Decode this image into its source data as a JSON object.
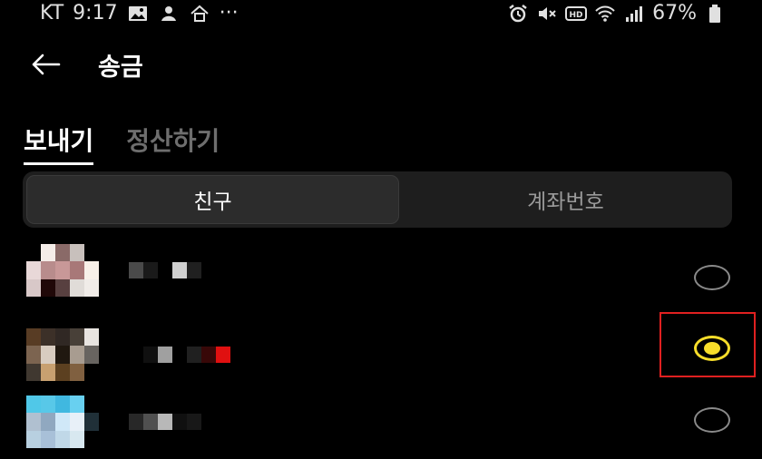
{
  "status_bar": {
    "carrier": "KT",
    "time": "9:17",
    "more": "···",
    "battery": "67%"
  },
  "header": {
    "title": "송금"
  },
  "tabs": [
    {
      "label": "보내기",
      "active": true
    },
    {
      "label": "정산하기",
      "active": false
    }
  ],
  "segment": {
    "options": [
      "친구",
      "계좌번호"
    ],
    "selected": "친구"
  },
  "friends": [
    {
      "selected": false,
      "avatar_colors": [
        "#000000",
        "#f4ece8",
        "#8a6a68",
        "#c8c0bc",
        "#000000",
        "#e8d8d8",
        "#b88c8c",
        "#c89898",
        "#a87878",
        "#f8f0e8",
        "#d8c8c8",
        "#200808",
        "#584040",
        "#e0dcd8",
        "#f0ece8"
      ],
      "name_colors": [
        "#4a4a4a",
        "#1a1a1a",
        "#000000",
        "#d0d0d0",
        "#202020"
      ]
    },
    {
      "selected": true,
      "avatar_colors": [
        "#583c24",
        "#3c3028",
        "#302824",
        "#484038",
        "#e8e4e0",
        "#7c6450",
        "#d8ccc0",
        "#201810",
        "#a89c90",
        "#686460",
        "#403830",
        "#c8a070",
        "#5c4020",
        "#806040",
        "#000000"
      ],
      "name_colors": [
        "#000000",
        "#101010",
        "#a0a0a0",
        "#000000",
        "#202020",
        "#380808",
        "#e01010"
      ]
    },
    {
      "selected": false,
      "avatar_colors": [
        "#50c8e8",
        "#58c8e8",
        "#40b8e0",
        "#68d0f0",
        "#000000",
        "#b0c0d0",
        "#90a8c0",
        "#d0e8f8",
        "#e8f0f8",
        "#203038",
        "#b8d0e0",
        "#a8c0d8",
        "#c0d8e8",
        "#d8e8f0",
        "#000000"
      ],
      "name_colors": [
        "#282828",
        "#505050",
        "#b8b8b8",
        "#101010",
        "#181818"
      ]
    }
  ]
}
